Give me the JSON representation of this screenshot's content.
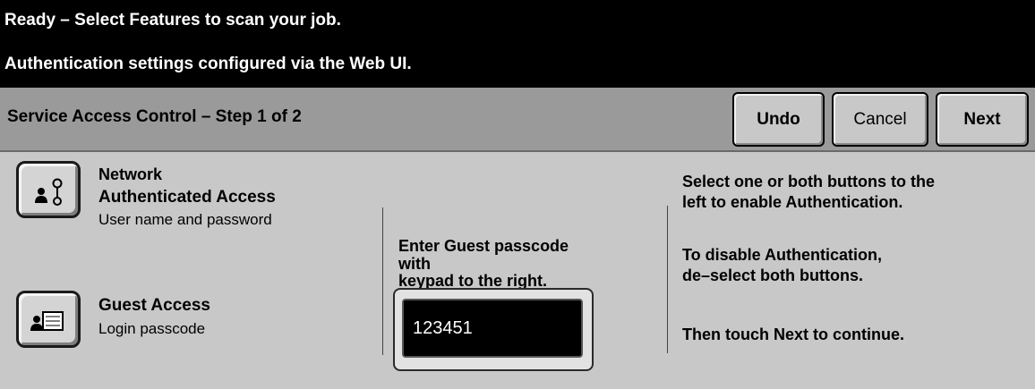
{
  "status": {
    "line1": "Ready –  Select Features to scan your job.",
    "line2": "Authentication settings configured via the Web UI."
  },
  "header": {
    "title": "Service Access Control – Step 1 of 2",
    "undo_label": "Undo",
    "cancel_label": "Cancel",
    "next_label": "Next"
  },
  "options": {
    "network": {
      "title_line1": "Network",
      "title_line2": "Authenticated Access",
      "subtitle": "User name and password",
      "icon": "user-key-icon"
    },
    "guest": {
      "title": "Guest Access",
      "subtitle": "Login passcode",
      "icon": "user-card-icon"
    }
  },
  "passcode": {
    "prompt_line1": "Enter Guest passcode",
    "prompt_line2": "with",
    "prompt_line3": "keypad to the right.",
    "value": "123451"
  },
  "instructions": {
    "line1": "Select one or both buttons to the",
    "line2": "left to enable Authentication.",
    "line3": "To disable Authentication,",
    "line4": "de–select both buttons.",
    "line5": "Then touch Next to continue."
  }
}
